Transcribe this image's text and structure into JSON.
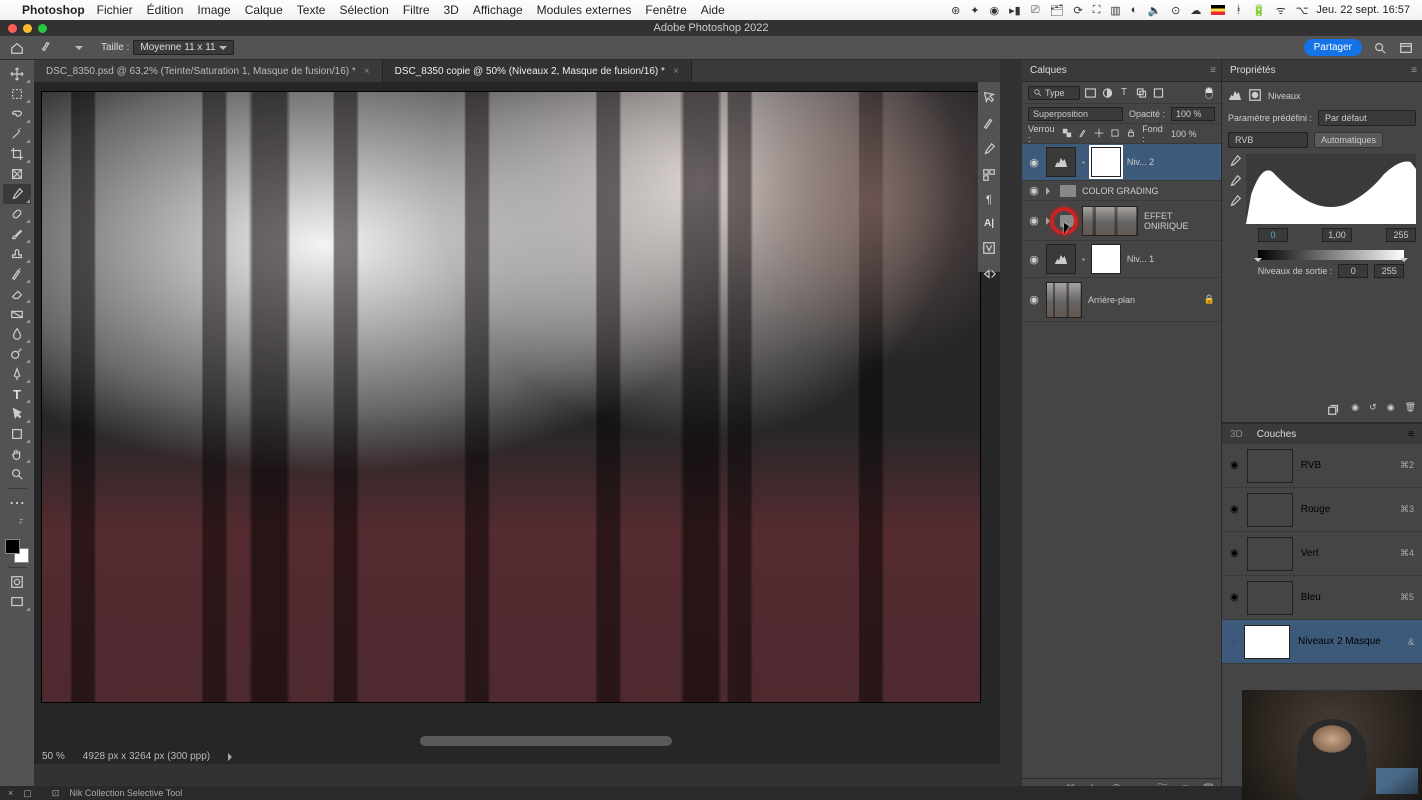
{
  "menubar": {
    "app": "Photoshop",
    "items": [
      "Fichier",
      "Édition",
      "Image",
      "Calque",
      "Texte",
      "Sélection",
      "Filtre",
      "3D",
      "Affichage",
      "Modules externes",
      "Fenêtre",
      "Aide"
    ],
    "clock": "Jeu. 22 sept.  16:57"
  },
  "title": "Adobe Photoshop 2022",
  "options": {
    "size_label": "Taille :",
    "size_value": "Moyenne 11 x 11",
    "share": "Partager"
  },
  "tabs": [
    {
      "label": "DSC_8350.psd @ 63,2% (Teinte/Saturation 1, Masque de fusion/16) *",
      "active": false
    },
    {
      "label": "DSC_8350 copie @ 50% (Niveaux 2, Masque de fusion/16) *",
      "active": true
    }
  ],
  "canvas_status": {
    "zoom": "50 %",
    "info": "4928 px x 3264 px (300 ppp)"
  },
  "layers_panel": {
    "title": "Calques",
    "filter_type": "Type",
    "blend": {
      "mode": "Superposition",
      "opacity_label": "Opacité :",
      "opacity": "100 %"
    },
    "lock": {
      "label": "Verrou :",
      "fill_label": "Fond :",
      "fill": "100 %"
    },
    "layers": [
      {
        "name": "Niv... 2",
        "kind": "levels",
        "selected": true,
        "mask": true
      },
      {
        "name": "COLOR GRADING",
        "kind": "group"
      },
      {
        "name": "EFFET ONIRIQUE",
        "kind": "group-with-thumb",
        "highlight": true
      },
      {
        "name": "Niv... 1",
        "kind": "levels",
        "mask": true
      },
      {
        "name": "Arrière-plan",
        "kind": "bg",
        "locked": true
      }
    ]
  },
  "properties_panel": {
    "title": "Propriétés",
    "adj_label": "Niveaux",
    "preset_label": "Paramètre prédéfini :",
    "preset_value": "Par défaut",
    "channel": "RVB",
    "auto": "Automatiques",
    "input": [
      "0",
      "1,00",
      "255"
    ],
    "output_label": "Niveaux de sortie :",
    "output": [
      "0",
      "255"
    ]
  },
  "channels_panel": {
    "tabs": [
      "3D",
      "Couches"
    ],
    "channels": [
      {
        "name": "RVB",
        "shortcut": "⌘2"
      },
      {
        "name": "Rouge",
        "shortcut": "⌘3"
      },
      {
        "name": "Vert",
        "shortcut": "⌘4"
      },
      {
        "name": "Bleu",
        "shortcut": "⌘5"
      },
      {
        "name": "Niveaux 2 Masque",
        "shortcut": "&",
        "selected": true
      }
    ]
  },
  "bottom_bar": {
    "label": "Nik Collection Selective Tool"
  }
}
